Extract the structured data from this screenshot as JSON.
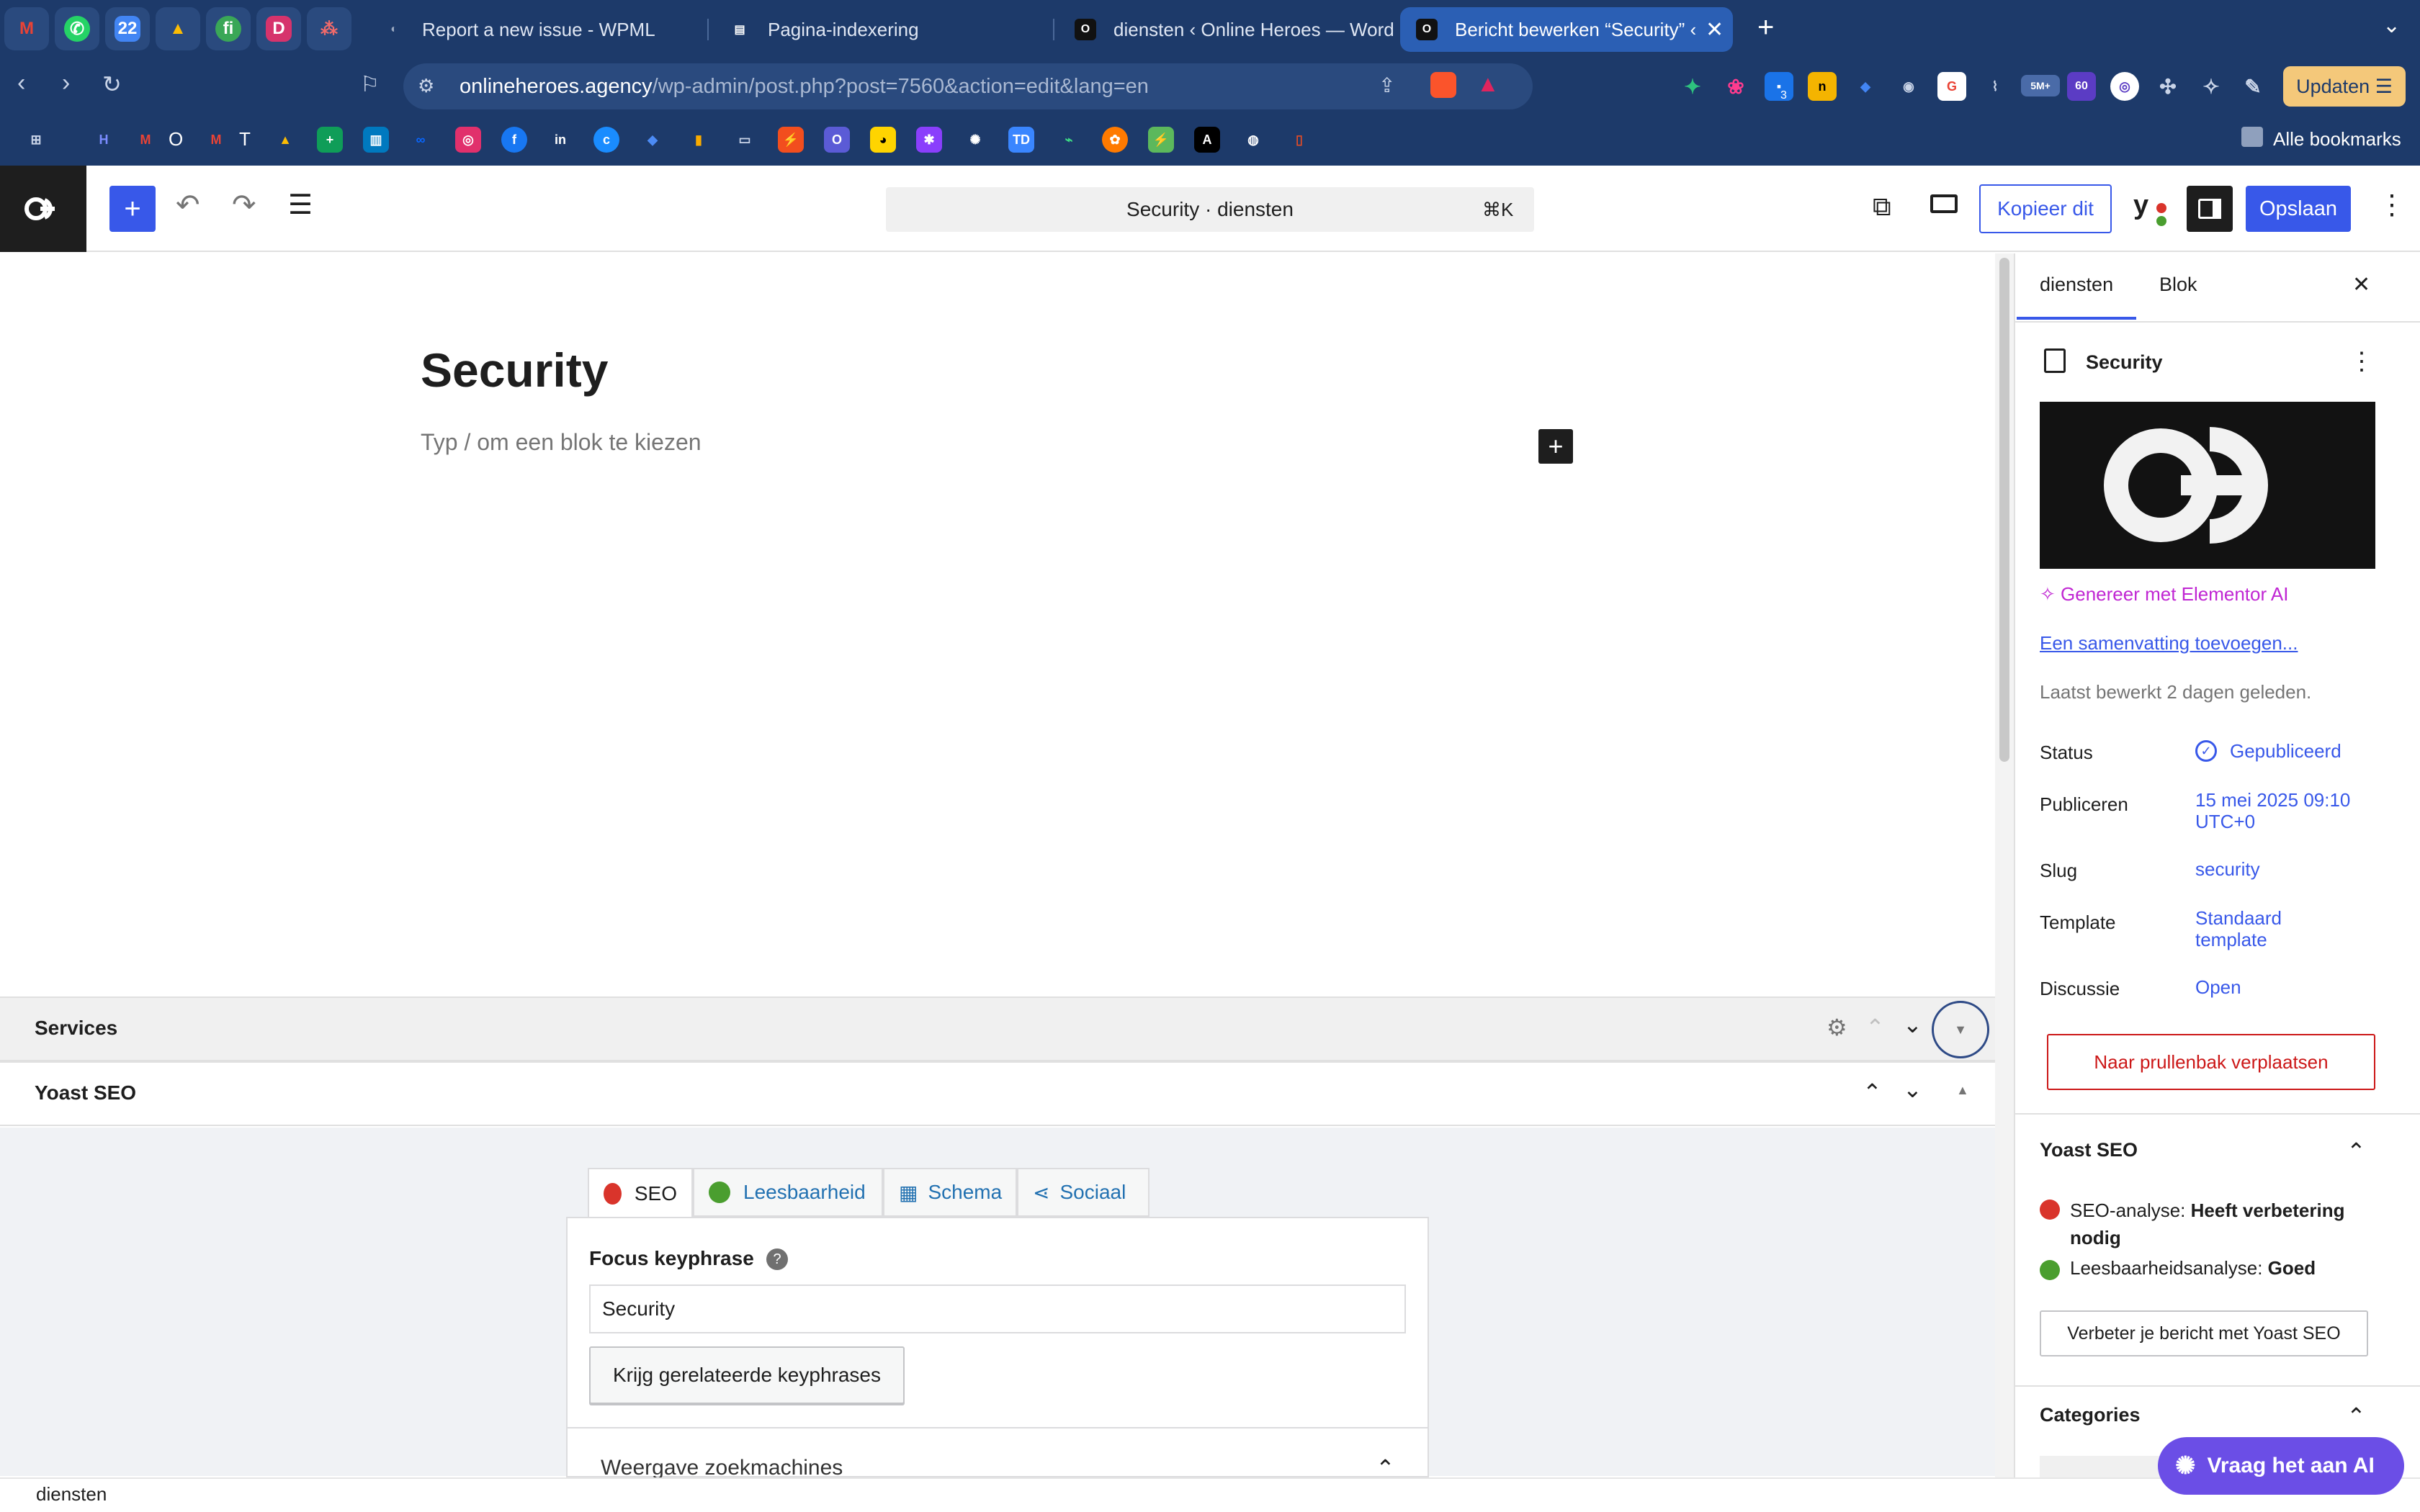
{
  "browser": {
    "tabs": [
      {
        "title": "Report a new issue - WPML"
      },
      {
        "title": "Pagina-indexering"
      },
      {
        "title": "diensten ‹ Online Heroes — Word"
      },
      {
        "title": "Bericht bewerken “Security” ‹"
      }
    ],
    "url_host": "onlineheroes.agency",
    "url_path": "/wp-admin/post.php?post=7560&action=edit&lang=en",
    "update_button": "Updaten",
    "ext_badges": {
      "b1": "3",
      "b2": "5M+",
      "b3": "60"
    },
    "bookmarks_all": "Alle bookmarks",
    "bm_letters": {
      "m": "O",
      "t": "T"
    }
  },
  "editor": {
    "command_bar": "Security · diensten",
    "command_shortcut": "⌘K",
    "copy_button": "Kopieer dit",
    "save_button": "Opslaan",
    "post_title": "Security",
    "block_placeholder": "Typ / om een blok te kiezen"
  },
  "metaboxes": {
    "services_title": "Services",
    "yoast_title": "Yoast SEO"
  },
  "yoast": {
    "tabs": {
      "seo": "SEO",
      "readability": "Leesbaarheid",
      "schema": "Schema",
      "social": "Sociaal"
    },
    "focus_label": "Focus keyphrase",
    "focus_value": "Security",
    "related_button": "Krijg gerelateerde keyphrases",
    "serp_heading": "Weergave zoekmachines"
  },
  "sidebar": {
    "tab_post": "diensten",
    "tab_block": "Blok",
    "post_name": "Security",
    "generate_ai": "Genereer met Elementor AI",
    "excerpt_link": "Een samenvatting toevoegen...",
    "last_edited": "Laatst bewerkt 2 dagen geleden.",
    "rows": {
      "status_label": "Status",
      "status_value": "Gepubliceerd",
      "publish_label": "Publiceren",
      "publish_line1": "15 mei 2025 09:10",
      "publish_line2": "UTC+0",
      "slug_label": "Slug",
      "slug_value": "security",
      "template_label": "Template",
      "template_line1": "Standaard",
      "template_line2": "template",
      "discussion_label": "Discussie",
      "discussion_value": "Open"
    },
    "trash_button": "Naar prullenbak verplaatsen",
    "yoast_panel": "Yoast SEO",
    "seo_analysis_label": "SEO-analyse:",
    "seo_analysis_value": "Heeft verbetering",
    "seo_analysis_value2": "nodig",
    "read_analysis_label": "Leesbaarheidsanalyse:",
    "read_analysis_value": "Goed",
    "improve_button": "Verbeter je bericht met Yoast SEO",
    "categories_panel": "Categories"
  },
  "footer": {
    "breadcrumb": "diensten",
    "ai_button": "Vraag het aan AI"
  },
  "colors": {
    "accent": "#3858e9",
    "chrome": "#1d3a6a",
    "danger": "#cc1818",
    "yoast_good": "#4a9e2f",
    "yoast_bad": "#d9342b",
    "ai_purple": "#6b4ee6"
  }
}
